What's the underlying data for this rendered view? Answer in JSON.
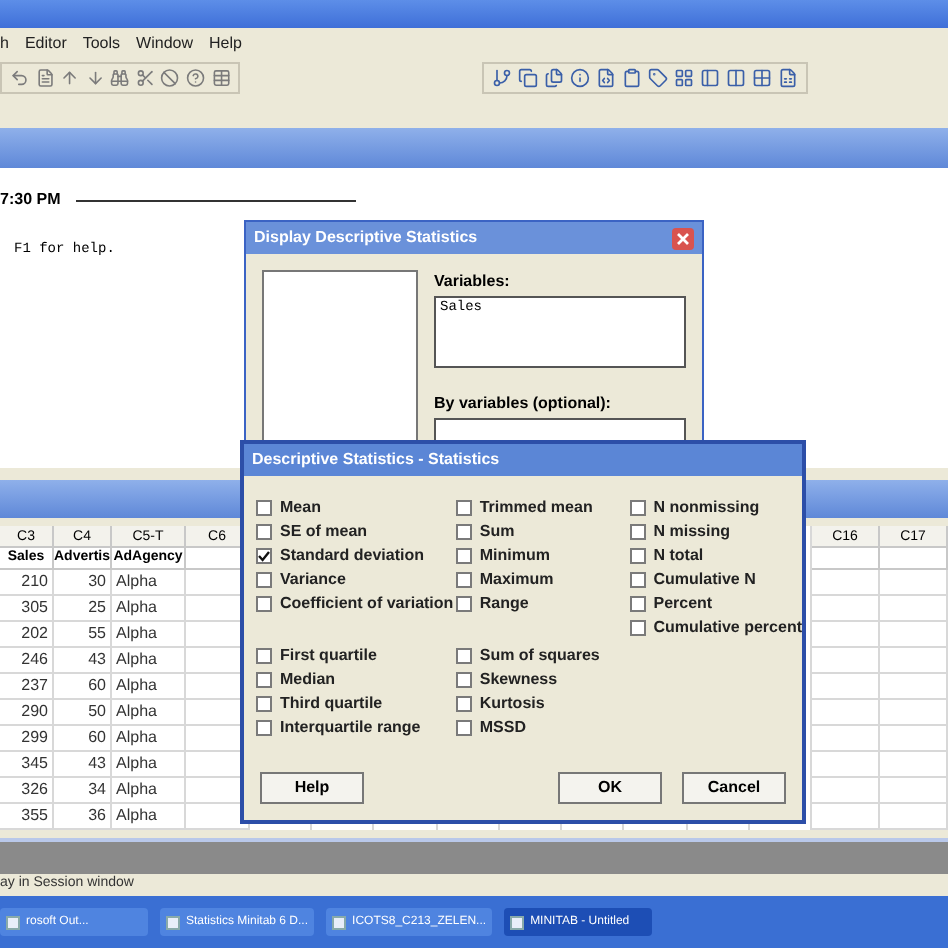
{
  "menu_bar": {
    "items": [
      "h",
      "Editor",
      "Tools",
      "Window",
      "Help"
    ]
  },
  "session": {
    "timestamp": "7:30 PM",
    "hint": "F1 for help."
  },
  "display_dialog": {
    "title": "Display Descriptive Statistics",
    "variables_label": "Variables:",
    "variables_value": "Sales",
    "by_variables_label": "By variables (optional):"
  },
  "worksheet": {
    "columns": [
      {
        "id": "C3",
        "name": "Sales",
        "kind": "numeric",
        "cells": [
          "210",
          "305",
          "202",
          "246",
          "237",
          "290",
          "299",
          "345",
          "326",
          "355"
        ]
      },
      {
        "id": "C4",
        "name": "Advertis",
        "kind": "numeric",
        "cells": [
          "30",
          "25",
          "55",
          "43",
          "60",
          "50",
          "60",
          "43",
          "34",
          "36"
        ]
      },
      {
        "id": "C5-T",
        "name": "AdAgency",
        "kind": "text",
        "cells": [
          "Alpha",
          "Alpha",
          "Alpha",
          "Alpha",
          "Alpha",
          "Alpha",
          "Alpha",
          "Alpha",
          "Alpha",
          "Alpha"
        ]
      },
      {
        "id": "C6",
        "kind": "numeric"
      },
      {
        "id": "C16",
        "kind": "numeric"
      },
      {
        "id": "C17",
        "kind": "numeric"
      }
    ]
  },
  "statistics_dialog": {
    "title": "Descriptive Statistics - Statistics",
    "columns": [
      {
        "top": [
          {
            "label": "Mean",
            "checked": false
          },
          {
            "label": "SE of mean",
            "checked": false
          },
          {
            "label": "Standard deviation",
            "checked": true
          },
          {
            "label": "Variance",
            "checked": false
          },
          {
            "label": "Coefficient of variation",
            "checked": false
          }
        ],
        "bottom": [
          {
            "label": "First quartile",
            "checked": false
          },
          {
            "label": "Median",
            "checked": false
          },
          {
            "label": "Third quartile",
            "checked": false
          },
          {
            "label": "Interquartile range",
            "checked": false
          }
        ]
      },
      {
        "top": [
          {
            "label": "Trimmed mean",
            "checked": false
          },
          {
            "label": "Sum",
            "checked": false
          },
          {
            "label": "Minimum",
            "checked": false
          },
          {
            "label": "Maximum",
            "checked": false
          },
          {
            "label": "Range",
            "checked": false
          }
        ],
        "bottom": [
          {
            "label": "Sum of squares",
            "checked": false
          },
          {
            "label": "Skewness",
            "checked": false
          },
          {
            "label": "Kurtosis",
            "checked": false
          },
          {
            "label": "MSSD",
            "checked": false
          }
        ]
      },
      {
        "top": [
          {
            "label": "N nonmissing",
            "checked": false
          },
          {
            "label": "N missing",
            "checked": false
          },
          {
            "label": "N total",
            "checked": false
          },
          {
            "label": "Cumulative N",
            "checked": false
          },
          {
            "label": "Percent",
            "checked": false
          },
          {
            "label": "Cumulative percent",
            "checked": false
          }
        ]
      }
    ],
    "buttons": [
      "Help",
      "OK",
      "Cancel"
    ]
  },
  "status_bar": {
    "text": "ay in Session window"
  },
  "taskbar": [
    {
      "label": "rosoft Out...",
      "selected": false
    },
    {
      "label": "Statistics Minitab 6 D...",
      "selected": false
    },
    {
      "label": "ICOTS8_C213_ZELEN...",
      "selected": false
    },
    {
      "label": "MINITAB - Untitled",
      "selected": true
    }
  ]
}
